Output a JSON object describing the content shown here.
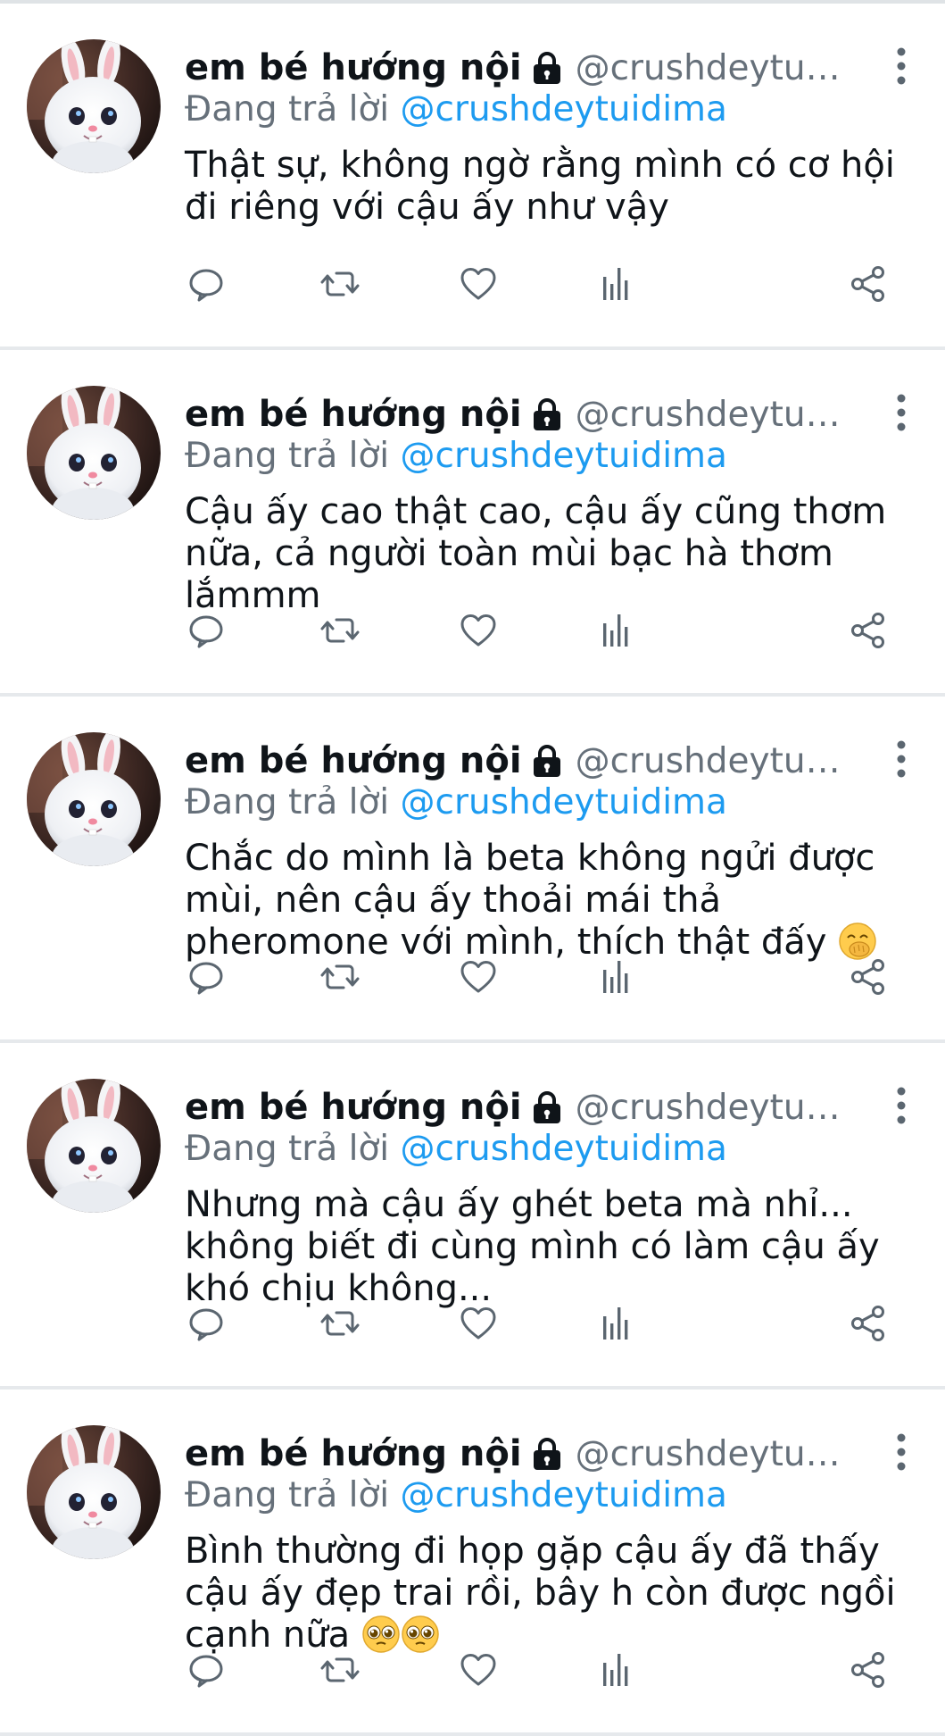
{
  "colors": {
    "text": "#0f1419",
    "secondary": "#66707a",
    "mention": "#1d9bf0",
    "divider": "#e6e9ec",
    "icon": "#5b6670"
  },
  "icons": {
    "lock": "lock-icon",
    "more": "more-vertical-icon",
    "reply": "reply-bubble-icon",
    "retweet": "retweet-icon",
    "like": "heart-icon",
    "views": "analytics-bars-icon",
    "share": "share-icon",
    "avatar": "white-rabbit-avatar"
  },
  "tweets": [
    {
      "display_name": "em bé hướng nội",
      "handle": "@crushdeytuidi···",
      "reply_prefix": "Đang trả lời ",
      "reply_to": "@crushdeytuidima",
      "text": "Thật sự, không ngờ rằng mình có cơ hội đi riêng với cậu ấy như vậy",
      "emojis": []
    },
    {
      "display_name": "em bé hướng nội",
      "handle": "@crushdeytuidi···",
      "reply_prefix": "Đang trả lời ",
      "reply_to": "@crushdeytuidima",
      "text": "Cậu ấy cao thật cao, cậu ấy cũng thơm nữa, cả người toàn mùi bạc hà thơm lắmmm",
      "emojis": []
    },
    {
      "display_name": "em bé hướng nội",
      "handle": "@crushdeytuidi···",
      "reply_prefix": "Đang trả lời ",
      "reply_to": "@crushdeytuidima",
      "text": "Chắc do mình là beta không ngửi được mùi, nên cậu ấy thoải mái thả pheromone với mình, thích thật đấy ",
      "emojis": [
        "hand-over-mouth-emoji"
      ]
    },
    {
      "display_name": "em bé hướng nội",
      "handle": "@crushdeytuidi···",
      "reply_prefix": "Đang trả lời ",
      "reply_to": "@crushdeytuidima",
      "text": "Nhưng mà cậu ấy ghét beta mà nhỉ... không biết đi cùng mình có làm cậu ấy khó chịu không...",
      "emojis": []
    },
    {
      "display_name": "em bé hướng nội",
      "handle": "@crushdeytuidi···",
      "reply_prefix": "Đang trả lời ",
      "reply_to": "@crushdeytuidima",
      "text": "Bình thường đi họp gặp cậu ấy đã thấy cậu ấy đẹp trai rồi, bây h còn được ngồi cạnh nữa ",
      "emojis": [
        "pleading-face-emoji",
        "pleading-face-emoji"
      ]
    }
  ]
}
